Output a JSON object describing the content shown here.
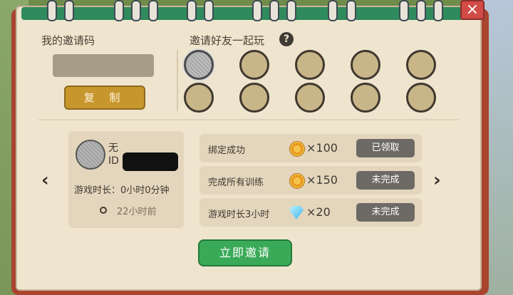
{
  "window": {
    "close_label": "×"
  },
  "invite_code": {
    "title": "我的邀请码",
    "code_value": "",
    "copy_label": "复 制"
  },
  "friends": {
    "title": "邀请好友一起玩",
    "help_label": "?",
    "slots": [
      {
        "filled": true
      },
      {
        "filled": false
      },
      {
        "filled": false
      },
      {
        "filled": false
      },
      {
        "filled": false
      },
      {
        "filled": false
      },
      {
        "filled": false
      },
      {
        "filled": false
      },
      {
        "filled": false
      },
      {
        "filled": false
      }
    ]
  },
  "player": {
    "name": "无",
    "id_label": "ID",
    "playtime": "游戏时长：0小时0分钟",
    "last_seen": "22小时前"
  },
  "nav": {
    "prev": "‹",
    "next": "›"
  },
  "rewards": [
    {
      "label": "绑定成功",
      "icon": "coin-icon",
      "amount": "×100",
      "status": "已领取"
    },
    {
      "label": "完成所有训练",
      "icon": "coin-icon",
      "amount": "×150",
      "status": "未完成"
    },
    {
      "label": "游戏时长3小时",
      "icon": "diamond-icon",
      "amount": "×20",
      "status": "未完成"
    }
  ],
  "invite_button": "立即邀请",
  "colors": {
    "accent_green": "#3aaa58",
    "accent_gold": "#c7972e",
    "close_red": "#d24c47"
  }
}
